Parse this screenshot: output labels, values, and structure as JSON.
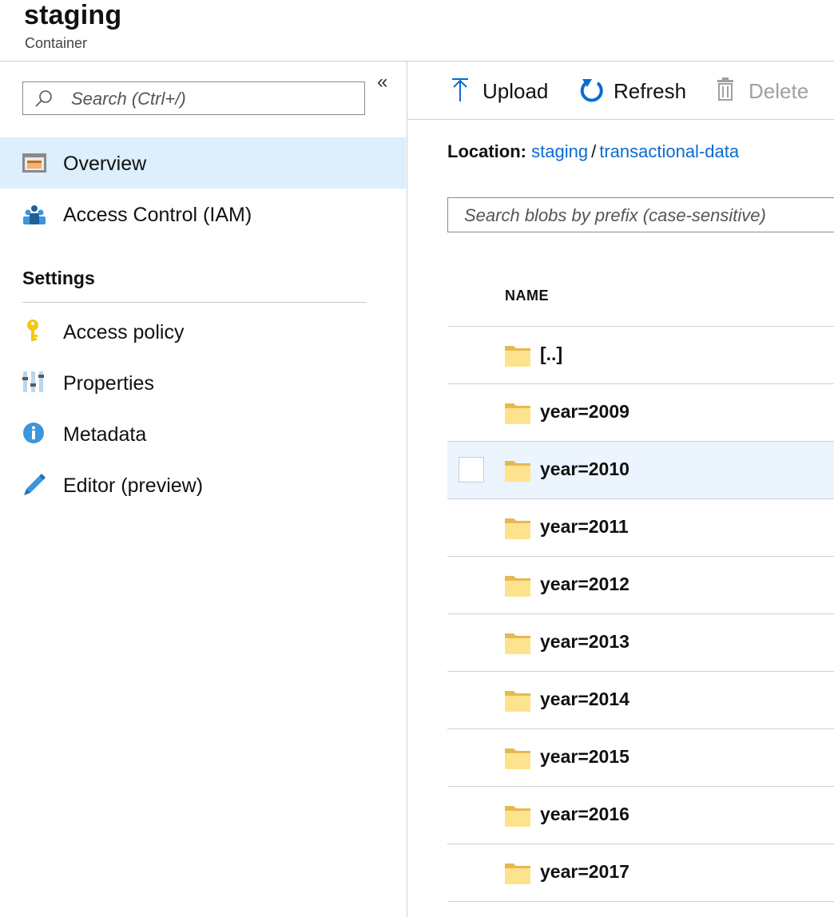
{
  "header": {
    "title": "staging",
    "subtitle": "Container"
  },
  "sidebar": {
    "search_placeholder": "Search (Ctrl+/)",
    "collapse_icon": "«",
    "items": [
      {
        "label": "Overview",
        "icon": "overview-icon",
        "active": true
      },
      {
        "label": "Access Control (IAM)",
        "icon": "iam-people-icon"
      }
    ],
    "settings_heading": "Settings",
    "settings_items": [
      {
        "label": "Access policy",
        "icon": "key-icon"
      },
      {
        "label": "Properties",
        "icon": "properties-sliders-icon"
      },
      {
        "label": "Metadata",
        "icon": "info-icon"
      },
      {
        "label": "Editor (preview)",
        "icon": "pencil-icon"
      }
    ]
  },
  "toolbar": {
    "upload_label": "Upload",
    "refresh_label": "Refresh",
    "delete_label": "Delete"
  },
  "location": {
    "label": "Location:",
    "crumbs": [
      "staging",
      "transactional-data"
    ],
    "separator": "/"
  },
  "blob_search": {
    "placeholder": "Search blobs by prefix (case-sensitive)"
  },
  "table": {
    "column_name": "NAME",
    "rows": [
      "[..]",
      "year=2009",
      "year=2010",
      "year=2011",
      "year=2012",
      "year=2013",
      "year=2014",
      "year=2015",
      "year=2016",
      "year=2017"
    ],
    "hover_row": "year=2010"
  },
  "colors": {
    "accent": "#0a6bd0",
    "active_nav_bg": "#ddeefc",
    "hover_row_bg": "#ecf4fd",
    "folder_yellow": "#fde38e"
  }
}
